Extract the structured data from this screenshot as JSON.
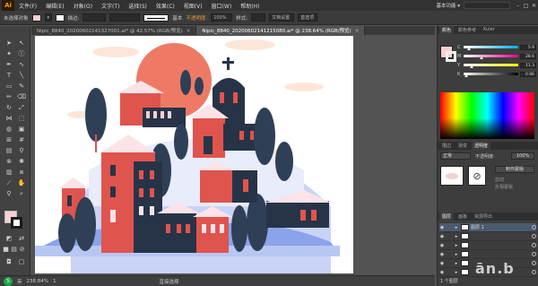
{
  "app": {
    "logo": "Ai",
    "menu": [
      "文件(F)",
      "编辑(E)",
      "对象(O)",
      "文字(T)",
      "选择(S)",
      "效果(C)",
      "视图(V)",
      "窗口(W)",
      "帮助(H)"
    ],
    "workspace": "基本功能 ▾"
  },
  "controlbar": {
    "no_selection": "未选择对象",
    "stroke_label": "描边:",
    "stroke_style": "基本",
    "opacity_label": "不透明度:",
    "opacity_value": "100%",
    "style_label": "样式:",
    "doc_setup": "文档设置",
    "prefs": "首选项"
  },
  "tabs": [
    {
      "label": "Nipic_8840_20200602141327001.ai* @ 42.57% (RGB/预览)",
      "active": false
    },
    {
      "label": "Nipic_8840_20200602141215080.ai* @ 238.64% (RGB/预览)",
      "active": true
    }
  ],
  "status": {
    "zoom": "238.84%",
    "page": "1",
    "selection": "直接选择",
    "ime": "S",
    "ime_label": "英"
  },
  "color_panel": {
    "tabs": [
      "颜色",
      "颜色参考",
      "Kuler"
    ],
    "sliders": [
      {
        "label": "C",
        "value": "5.9",
        "color": "#00aeef",
        "pos": 0.06
      },
      {
        "label": "M",
        "value": "28.6",
        "color": "#ec008c",
        "pos": 0.29
      },
      {
        "label": "Y",
        "value": "11.3",
        "color": "#fff200",
        "pos": 0.11
      },
      {
        "label": "K",
        "value": "0.96",
        "color": "#000000",
        "pos": 0.01
      }
    ],
    "fill_color": "#f9cfd4"
  },
  "transparency_panel": {
    "tabs": [
      "描边",
      "渐变",
      "透明度"
    ],
    "mode": "正常",
    "opacity_label": "不透明度:",
    "opacity": "100%",
    "make_mask": "制作蒙版",
    "clip": "剪切",
    "invert": "反相蒙版"
  },
  "layers_panel": {
    "tabs": [
      "图层",
      "画板",
      "资源导出"
    ],
    "layers": [
      {
        "name": "图层 1",
        "selected": true
      },
      {
        "name": "",
        "selected": false
      },
      {
        "name": "",
        "selected": false
      },
      {
        "name": "",
        "selected": false
      },
      {
        "name": "",
        "selected": false
      },
      {
        "name": "",
        "selected": false
      }
    ],
    "count": "1 个图层"
  },
  "watermark": "ān.b"
}
